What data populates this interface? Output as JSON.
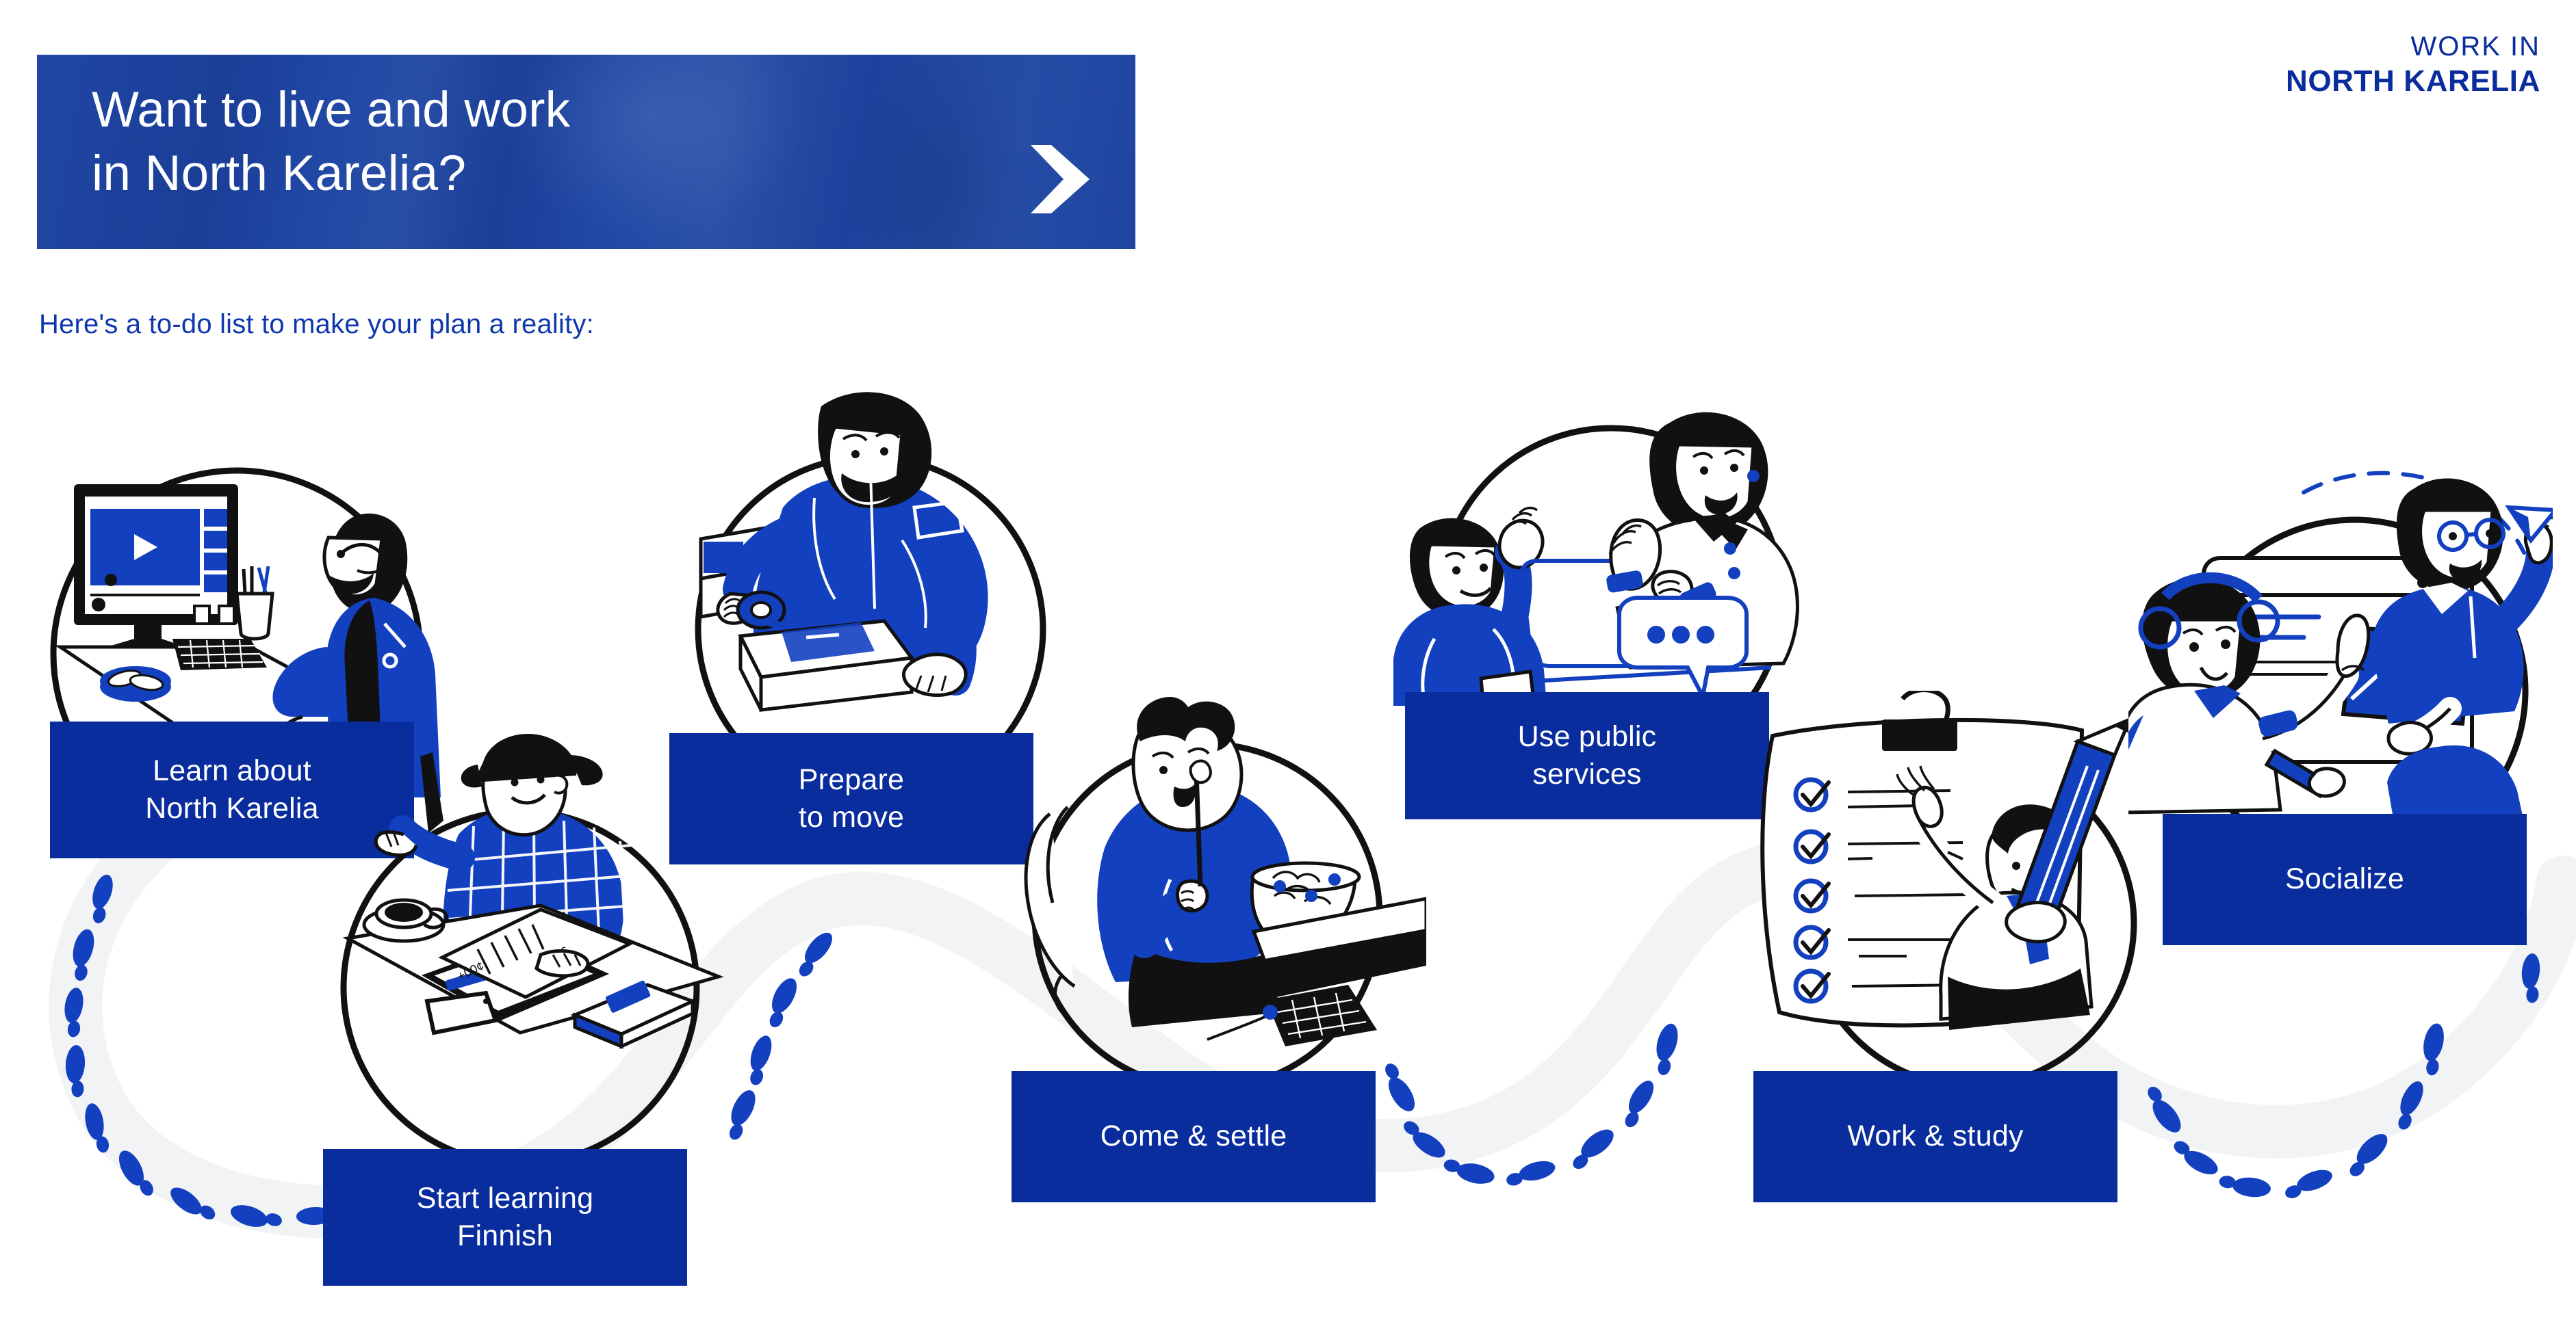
{
  "header": {
    "title": "Want to live and work\nin North Karelia?",
    "chevron_icon": "chevron-right-icon",
    "background_color": "#1f47a3"
  },
  "logo": {
    "line1": "WORK IN",
    "line2": "NORTH KARELIA",
    "color": "#0a2d9e"
  },
  "subtitle": {
    "text": "Here's a to-do list to make your plan a reality:",
    "color": "#0f37ad"
  },
  "theme": {
    "label_blue": "#0a2d9e",
    "accent_blue": "#1340bf",
    "illustration_blue": "#1340bf",
    "path_ribbon": "#f3f4f6",
    "ink": "#111111",
    "background": "#ffffff"
  },
  "steps": [
    {
      "index": 1,
      "label": "Learn about\nNorth Karelia",
      "illustration": "person-watching-video-on-monitor",
      "illustration_details": [
        "desktop-monitor",
        "video-player",
        "keyboard",
        "pen-cup",
        "plate-of-karelian-pies",
        "seated-person"
      ]
    },
    {
      "index": 2,
      "label": "Start learning\nFinnish",
      "illustration": "person-writing-notes-at-desk",
      "illustration_details": [
        "coffee-cup",
        "clipboard",
        "papers",
        "tablet",
        "books",
        "person-with-cap-and-plaid-shirt",
        "pen"
      ]
    },
    {
      "index": 3,
      "label": "Prepare\nto move",
      "illustration": "person-taping-moving-box",
      "illustration_details": [
        "cardboard-box",
        "packing-tape",
        "bearded-person"
      ]
    },
    {
      "index": 4,
      "label": "Come & settle",
      "illustration": "person-eating-salad-at-laptop",
      "illustration_details": [
        "bowl-of-salad-with-berries",
        "fork",
        "laptop",
        "chair",
        "person-with-bun-hairstyle"
      ]
    },
    {
      "index": 5,
      "label": "Use public\nservices",
      "illustration": "two-people-talking-with-speech-bubble",
      "illustration_details": [
        "waving-person",
        "service-desk",
        "speech-bubble-with-dots",
        "counter-staff"
      ]
    },
    {
      "index": 6,
      "label": "Work & study",
      "illustration": "checklist-on-clipboard-with-person",
      "illustration_details": [
        "binder-clip",
        "paper-sheet",
        "five-checkmarks",
        "large-pencil",
        "person-with-tie"
      ]
    },
    {
      "index": 7,
      "label": "Socialize",
      "illustration": "two-people-sharing-content-online",
      "illustration_details": [
        "browser-window",
        "image-card",
        "paper-plane",
        "headphones",
        "dashed-arc"
      ]
    }
  ]
}
